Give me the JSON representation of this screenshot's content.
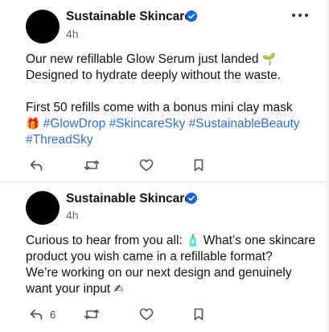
{
  "posts": [
    {
      "author": "Sustainable Skincare",
      "time": "4h",
      "lines": [
        {
          "text": "Our new refillable Glow Serum just landed ",
          "emoji": "🌱"
        },
        {
          "text": "Designed to hydrate deeply without the waste."
        },
        {
          "text": "First 50 refills come with a bonus mini clay mask"
        }
      ],
      "gift_emoji": "🎁",
      "hashtags": [
        "#GlowDrop",
        "#SkincareSky",
        "#SustainableBeauty",
        "#ThreadSky"
      ],
      "reply_count": ""
    },
    {
      "author": "Sustainable Skincare",
      "time": "4h",
      "lines": [
        {
          "text": "Curious to hear from you all: ",
          "emoji": "🧴",
          "text2": " What’s one skincare"
        },
        {
          "text": "product you wish came in a refillable format?"
        },
        {
          "text": "We’re working on our next design and genuinely"
        },
        {
          "text": "want your input ",
          "emoji": "✍"
        }
      ],
      "reply_count": "6"
    }
  ],
  "icons": {
    "verified": "verified-badge-icon",
    "more": "more-options-icon",
    "reply": "reply-icon",
    "repost": "repost-icon",
    "like": "heart-icon",
    "bookmark": "bookmark-icon"
  },
  "colors": {
    "accent": "#2e6fdc",
    "verified": "#1d63d8",
    "text": "#111111",
    "muted": "#666666"
  }
}
